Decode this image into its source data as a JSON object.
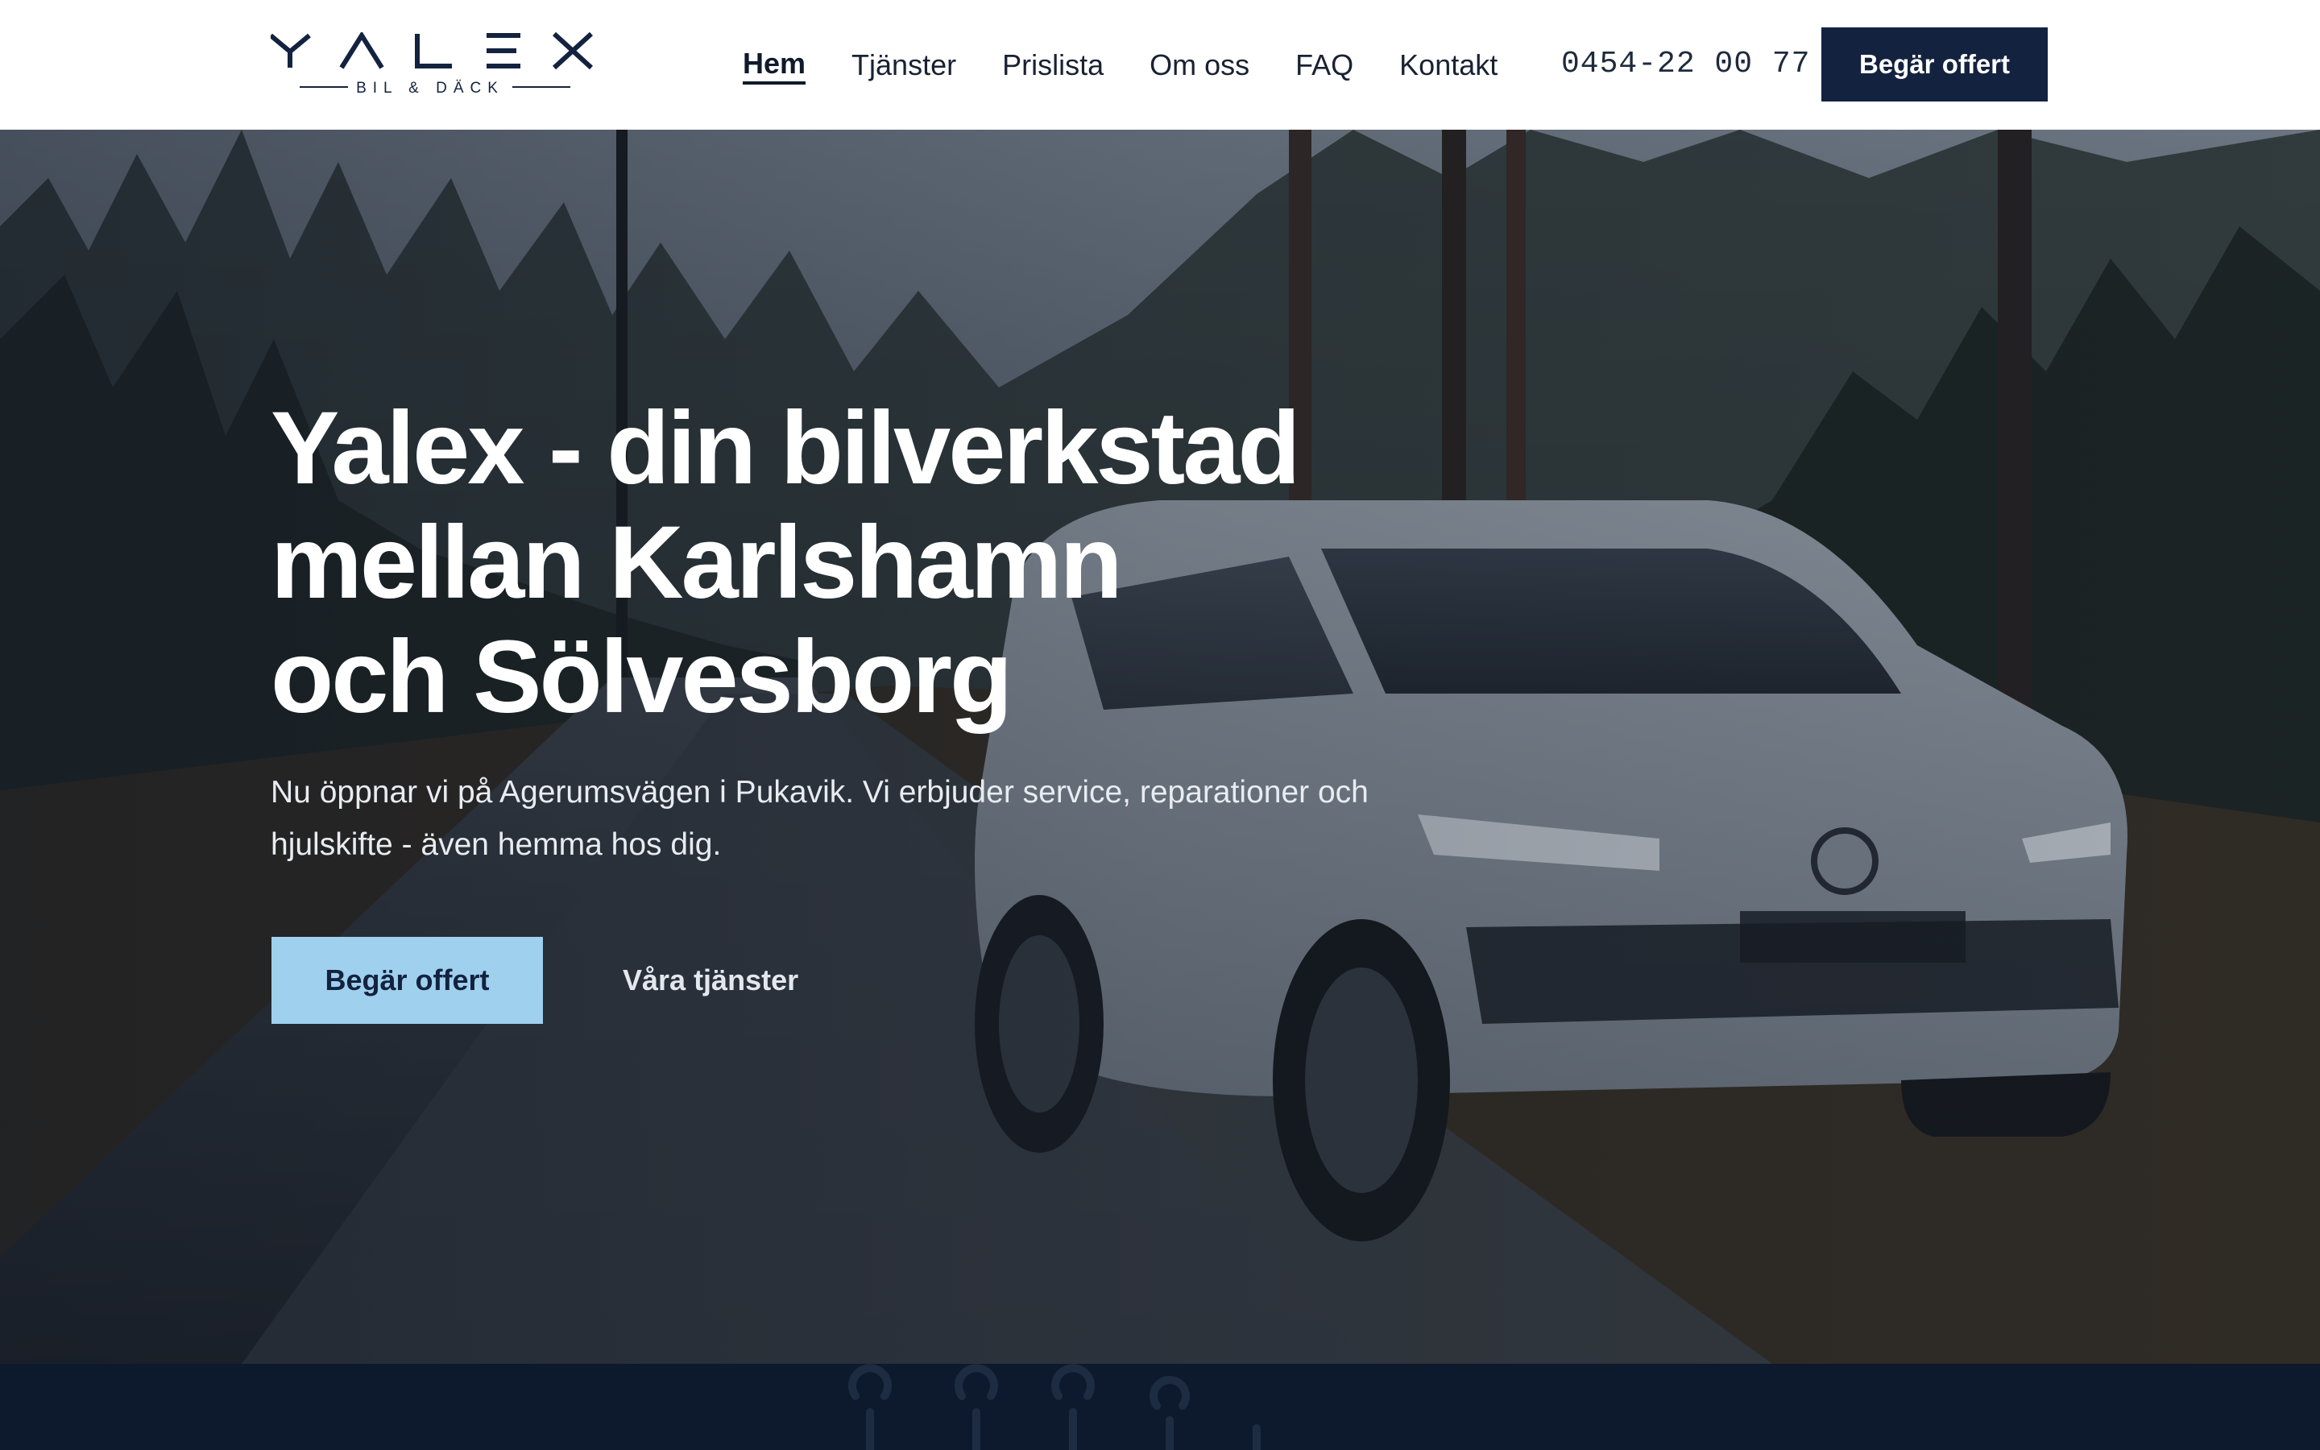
{
  "brand": {
    "logo_text": "YALEX",
    "logo_tagline": "BIL & DÄCK"
  },
  "nav": {
    "items": [
      {
        "label": "Hem",
        "active": true
      },
      {
        "label": "Tjänster",
        "active": false
      },
      {
        "label": "Prislista",
        "active": false
      },
      {
        "label": "Om oss",
        "active": false
      },
      {
        "label": "FAQ",
        "active": false
      },
      {
        "label": "Kontakt",
        "active": false
      }
    ],
    "phone": "0454-22 00 77",
    "cta_label": "Begär offert"
  },
  "hero": {
    "title_line1": "Yalex - din bilverkstad",
    "title_line2": "mellan Karlshamn",
    "title_line3": "och Sölvesborg",
    "subtitle_line1": "Nu öppnar vi på Agerumsvägen i Pukavik. Vi erbjuder service, reparationer och",
    "subtitle_line2": "hjulskifte - även hemma hos dig.",
    "primary_cta": "Begär offert",
    "secondary_cta": "Våra tjänster",
    "background_icon": "car-forest-photo"
  },
  "colors": {
    "navy": "#13223f",
    "light_blue": "#9fd0ee",
    "band": "#0d1a2d",
    "white": "#ffffff"
  }
}
